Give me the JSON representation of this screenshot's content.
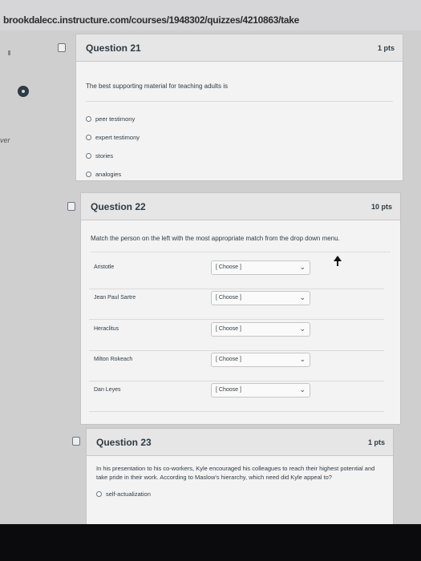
{
  "browser": {
    "url": "brookdalecc.instructure.com/courses/1948302/quizzes/4210863/take"
  },
  "sidebar": {
    "partial_text": "ver"
  },
  "questions": [
    {
      "title": "Question 21",
      "points": "1 pts",
      "prompt": "The best supporting material for teaching adults is",
      "answers": [
        "peer testimony",
        "expert testimony",
        "stories",
        "analogies"
      ]
    },
    {
      "title": "Question 22",
      "points": "10 pts",
      "prompt": "Match the person on the left with the most appropriate match from the drop down menu.",
      "matches": [
        {
          "label": "Aristotle",
          "value": "[ Choose ]"
        },
        {
          "label": "Jean Paul Sartre",
          "value": "[ Choose ]"
        },
        {
          "label": "Heraclitus",
          "value": "[ Choose ]"
        },
        {
          "label": "Milton Rokeach",
          "value": "[ Choose ]"
        },
        {
          "label": "Dan Leyes",
          "value": "[ Choose ]"
        }
      ]
    },
    {
      "title": "Question 23",
      "points": "1 pts",
      "prompt": "In his presentation to his co-workers, Kyle encouraged his colleagues to reach their highest potential and take pride in their work. According to Maslow's hierarchy, which need did Kyle appeal to?",
      "answers": [
        "self-actualization"
      ]
    }
  ],
  "icons": {
    "flag": "flag-icon",
    "dropdown": "chevron-down-icon",
    "cursor": "mouse-cursor-icon"
  }
}
